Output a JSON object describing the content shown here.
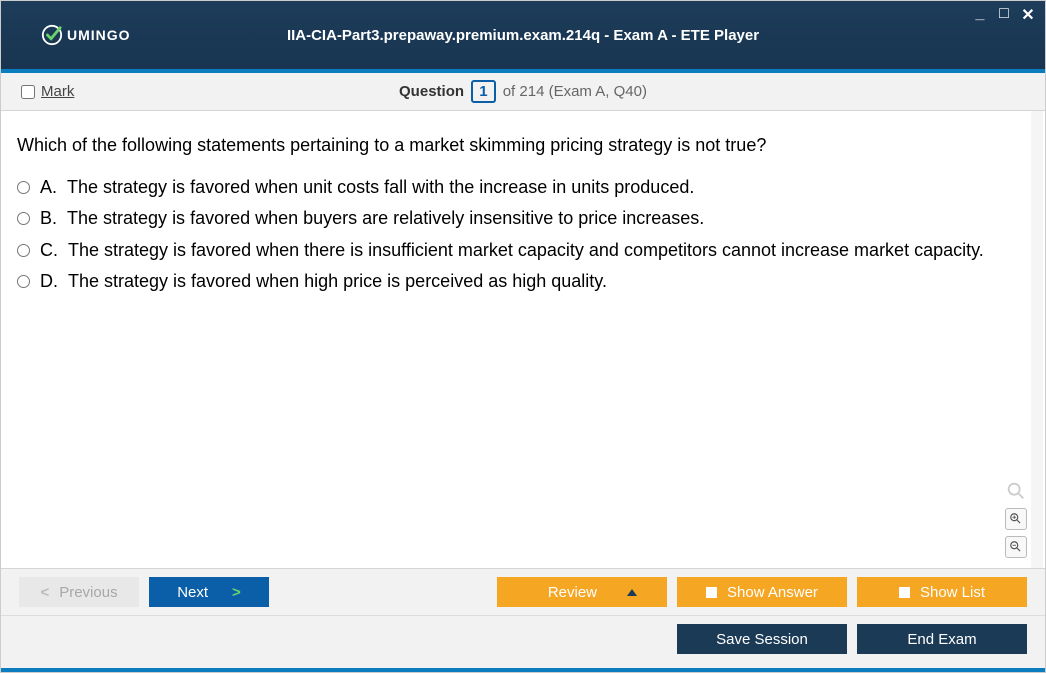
{
  "window": {
    "title": "IIA-CIA-Part3.prepaway.premium.exam.214q - Exam A - ETE Player",
    "logo_text": "UMINGO"
  },
  "header": {
    "mark_label": "Mark",
    "question_word": "Question",
    "question_number": "1",
    "of_text": "of 214 (Exam A, Q40)"
  },
  "question": {
    "text": "Which of the following statements pertaining to a market skimming pricing strategy is not true?",
    "answers": [
      {
        "letter": "A.",
        "text": "The strategy is favored when unit costs fall with the increase in units produced."
      },
      {
        "letter": "B.",
        "text": "The strategy is favored when buyers are relatively insensitive to price increases."
      },
      {
        "letter": "C.",
        "text": "The strategy is favored when there is insufficient market capacity and competitors cannot increase market capacity."
      },
      {
        "letter": "D.",
        "text": "The strategy is favored when high price is perceived as high quality."
      }
    ]
  },
  "footer": {
    "previous": "Previous",
    "next": "Next",
    "review": "Review",
    "show_answer": "Show Answer",
    "show_list": "Show List",
    "save_session": "Save Session",
    "end_exam": "End Exam"
  }
}
